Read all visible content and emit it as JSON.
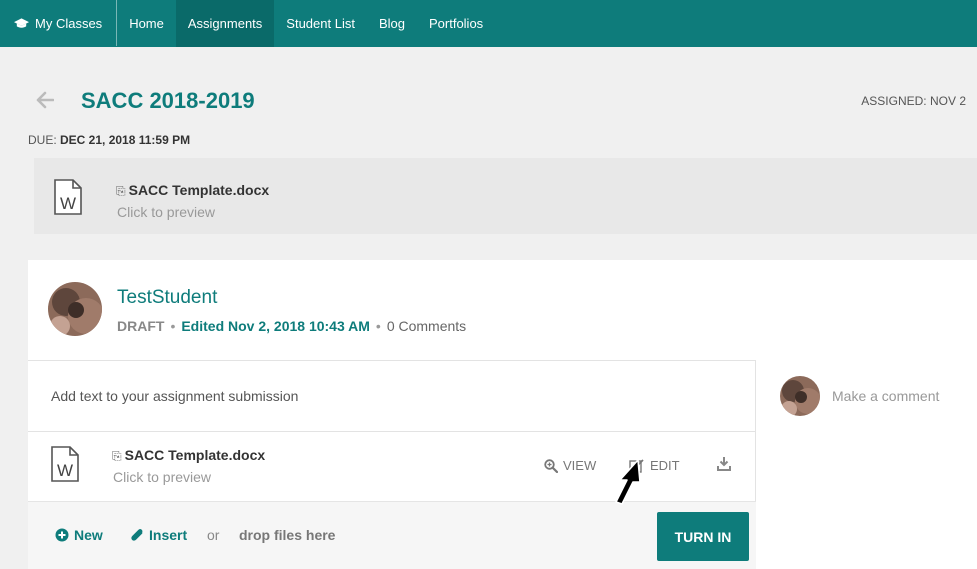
{
  "nav": {
    "brand": "My Classes",
    "items": [
      {
        "label": "Home",
        "active": false
      },
      {
        "label": "Assignments",
        "active": true
      },
      {
        "label": "Student List",
        "active": false
      },
      {
        "label": "Blog",
        "active": false
      },
      {
        "label": "Portfolios",
        "active": false
      }
    ]
  },
  "assignment": {
    "title": "SACC 2018-2019",
    "assigned_label": "ASSIGNED:",
    "assigned_value": "NOV 2",
    "due_label": "DUE:",
    "due_value": "DEC 21, 2018 11:59 PM",
    "attachment": {
      "name": "SACC Template.docx",
      "sub": "Click to preview"
    }
  },
  "submission": {
    "student": "TestStudent",
    "status": "DRAFT",
    "edited": "Edited Nov 2, 2018 10:43 AM",
    "comments": "0 Comments",
    "text_placeholder": "Add text to your assignment submission",
    "file": {
      "name": "SACC Template.docx",
      "sub": "Click to preview"
    },
    "actions": {
      "view": "VIEW",
      "edit": "EDIT"
    },
    "new_label": "New",
    "insert_label": "Insert",
    "or_label": "or",
    "drop_label": "drop files here",
    "turn_in_label": "TURN IN",
    "comment_placeholder": "Make a comment"
  },
  "colors": {
    "accent": "#0e7c7b",
    "nav_active": "#0a6a69"
  },
  "icons": {
    "brand": "graduation-cap-icon",
    "back": "arrow-left-icon",
    "doc": "word-document-icon",
    "view": "search-plus-icon",
    "edit": "edit-icon",
    "download": "download-icon",
    "new": "plus-circle-icon",
    "insert": "paperclip-icon"
  }
}
